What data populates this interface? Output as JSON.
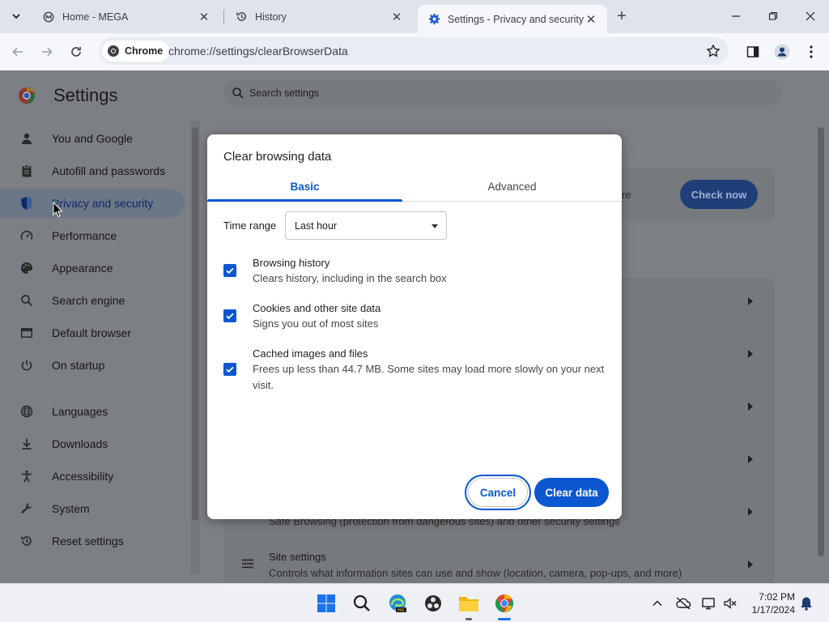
{
  "browser": {
    "tabs": [
      {
        "label": "Home - MEGA",
        "icon": "mega-icon"
      },
      {
        "label": "History",
        "icon": "history-icon"
      },
      {
        "label": "Settings - Privacy and security",
        "icon": "settings-gear-icon",
        "active": true
      }
    ],
    "chip_label": "Chrome",
    "url": "chrome://settings/clearBrowserData"
  },
  "settings": {
    "title": "Settings",
    "search_placeholder": "Search settings",
    "nav": [
      {
        "label": "You and Google",
        "icon": "person-icon"
      },
      {
        "label": "Autofill and passwords",
        "icon": "clipboard-icon"
      },
      {
        "label": "Privacy and security",
        "icon": "shield-icon",
        "selected": true
      },
      {
        "label": "Performance",
        "icon": "speedometer-icon"
      },
      {
        "label": "Appearance",
        "icon": "palette-icon"
      },
      {
        "label": "Search engine",
        "icon": "search-icon"
      },
      {
        "label": "Default browser",
        "icon": "browser-icon"
      },
      {
        "label": "On startup",
        "icon": "power-icon"
      },
      {
        "label": "Languages",
        "icon": "globe-icon"
      },
      {
        "label": "Downloads",
        "icon": "download-icon"
      },
      {
        "label": "Accessibility",
        "icon": "accessibility-icon"
      },
      {
        "label": "System",
        "icon": "wrench-icon"
      },
      {
        "label": "Reset settings",
        "icon": "reset-icon"
      }
    ],
    "check_now": "Check now",
    "safety_fragment": "re",
    "safe_browsing_partial": "Safe Browsing (protection from dangerous sites) and other security settings",
    "site_settings_title": "Site settings",
    "site_settings_desc": "Controls what information sites can use and show (location, camera, pop-ups, and more)"
  },
  "dialog": {
    "title": "Clear browsing data",
    "tabs": [
      "Basic",
      "Advanced"
    ],
    "active_tab": "Basic",
    "time_range_label": "Time range",
    "time_range_value": "Last hour",
    "options": [
      {
        "title": "Browsing history",
        "desc": "Clears history, including in the search box",
        "checked": true
      },
      {
        "title": "Cookies and other site data",
        "desc": "Signs you out of most sites",
        "checked": true
      },
      {
        "title": "Cached images and files",
        "desc": "Frees up less than 44.7 MB. Some sites may load more slowly on your next visit.",
        "checked": true
      }
    ],
    "cancel_label": "Cancel",
    "clear_label": "Clear data"
  },
  "taskbar": {
    "time": "7:02 PM",
    "date": "1/17/2024"
  },
  "colors": {
    "accent": "#0b57d0",
    "checkbox": "#0b57d0"
  }
}
